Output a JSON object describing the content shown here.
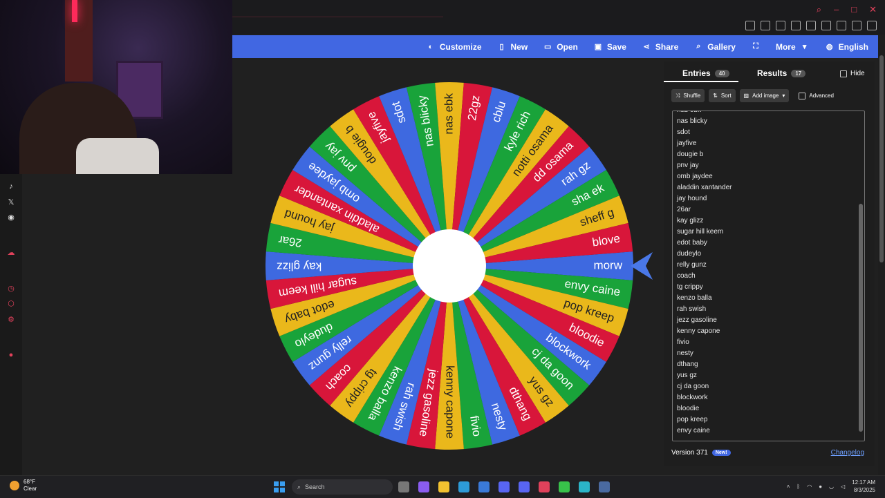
{
  "toolbar": {
    "items": [
      {
        "label": "Customize",
        "icon": "palette-icon"
      },
      {
        "label": "New",
        "icon": "file-icon"
      },
      {
        "label": "Open",
        "icon": "folder-icon"
      },
      {
        "label": "Save",
        "icon": "save-icon"
      },
      {
        "label": "Share",
        "icon": "share-icon"
      },
      {
        "label": "Gallery",
        "icon": "search-icon"
      },
      {
        "label": "",
        "icon": "fullscreen-icon"
      },
      {
        "label": "More",
        "icon": "chevron-down-icon"
      },
      {
        "label": "English",
        "icon": "globe-icon"
      }
    ]
  },
  "wheel": {
    "segments": [
      "morw",
      "envy caine",
      "pop kreep",
      "bloodie",
      "blockwork",
      "cj da goon",
      "yus gz",
      "dthang",
      "nesty",
      "fivio",
      "kenny capone",
      "jezz gasoline",
      "rah swish",
      "kenzo balla",
      "tg crippy",
      "coach",
      "relly gunz",
      "dudeylo",
      "edot baby",
      "sugar hill keem",
      "kay glizz",
      "26ar",
      "jay hound",
      "aladdin xantander",
      "omb jaydee",
      "pnv jay",
      "dougie b",
      "jayfive",
      "sdot",
      "nas blicky",
      "nas ebk",
      "22gz",
      "cblu",
      "kyle rich",
      "notti osama",
      "dd osama",
      "rah gz",
      "sha ek",
      "sheff g",
      "blove"
    ],
    "colors": [
      "#3e69e0",
      "#19a33a",
      "#eab81b",
      "#d8163a"
    ]
  },
  "panel": {
    "tab_entries": "Entries",
    "entries_count": "40",
    "tab_results": "Results",
    "results_count": "17",
    "hide_label": "Hide",
    "shuffle": "Shuffle",
    "sort": "Sort",
    "add_image": "Add image",
    "advanced": "Advanced",
    "version": "Version 371",
    "new_badge": "New!",
    "changelog": "Changelog",
    "entries": [
      "nas ebk",
      "nas blicky",
      "sdot",
      "jayfive",
      "dougie b",
      "pnv jay",
      "omb jaydee",
      "aladdin xantander",
      "jay hound",
      "26ar",
      "kay glizz",
      "sugar hill keem",
      "edot baby",
      "dudeylo",
      "relly gunz",
      "coach",
      "tg crippy",
      "kenzo balla",
      "rah swish",
      "jezz gasoline",
      "kenny capone",
      "fivio",
      "nesty",
      "dthang",
      "yus gz",
      "cj da goon",
      "blockwork",
      "bloodie",
      "pop kreep",
      "envy caine"
    ]
  },
  "taskbar": {
    "temp": "68°F",
    "weather": "Clear",
    "search_placeholder": "Search",
    "time": "12:17 AM",
    "date": "8/3/2025"
  }
}
